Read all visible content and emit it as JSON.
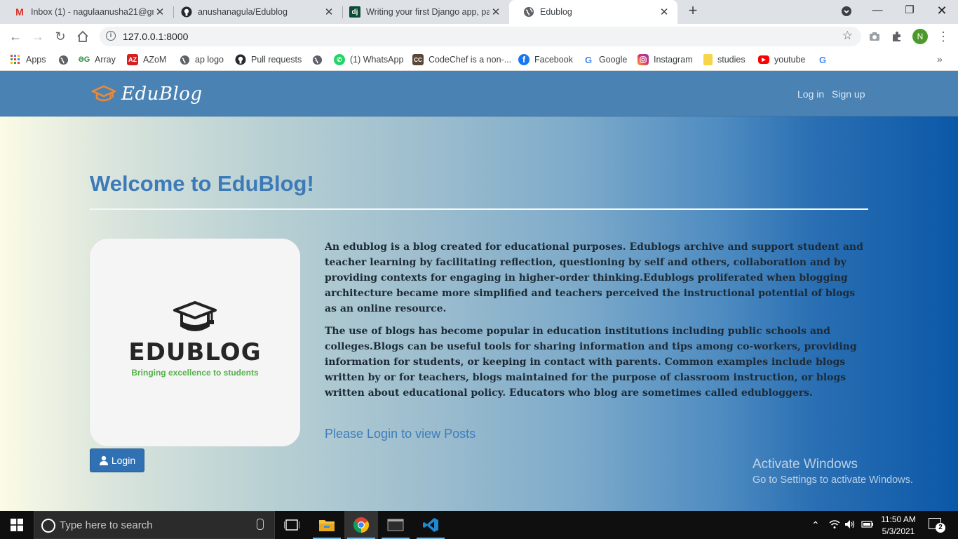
{
  "browser": {
    "tabs": [
      {
        "title": "Inbox (1) - nagulaanusha21@gm",
        "favicon": "gmail-icon",
        "active": false
      },
      {
        "title": "anushanagula/Edublog",
        "favicon": "github-icon",
        "active": false
      },
      {
        "title": "Writing your first Django app, pa",
        "favicon": "django-icon",
        "active": false
      },
      {
        "title": "Edublog",
        "favicon": "globe-icon",
        "active": true
      }
    ],
    "new_tab_label": "+",
    "url": "127.0.0.1:8000",
    "profile_initial": "N",
    "bookmarks": [
      {
        "label": "Apps",
        "icon": "apps-grid-icon"
      },
      {
        "label": "",
        "icon": "globe-icon"
      },
      {
        "label": "Array",
        "icon": "gfg-icon"
      },
      {
        "label": "AZoM",
        "icon": "azom-icon"
      },
      {
        "label": "ap logo",
        "icon": "globe-icon"
      },
      {
        "label": "Pull requests",
        "icon": "github-icon"
      },
      {
        "label": "",
        "icon": "globe-icon"
      },
      {
        "label": "(1) WhatsApp",
        "icon": "whatsapp-icon"
      },
      {
        "label": "CodeChef is a non-...",
        "icon": "codechef-icon"
      },
      {
        "label": "Facebook",
        "icon": "facebook-icon"
      },
      {
        "label": "Google",
        "icon": "google-icon"
      },
      {
        "label": "Instagram",
        "icon": "instagram-icon"
      },
      {
        "label": "studies",
        "icon": "folder-icon"
      },
      {
        "label": "youtube",
        "icon": "youtube-icon"
      },
      {
        "label": "",
        "icon": "google-icon"
      }
    ],
    "more_bookmarks": "»"
  },
  "site": {
    "brand": "EduBlog",
    "nav": {
      "login": "Log in",
      "signup": "Sign up"
    },
    "heading": "Welcome to EduBlog!",
    "logo": {
      "wordmark": "EDUBLOG",
      "tagline": "Bringing excellence to students"
    },
    "login_button": "Login",
    "paragraphs": [
      "An edublog is a blog created for educational purposes. Edublogs archive and support student and teacher learning by facilitating reflection, questioning by self and others, collaboration and by providing contexts for engaging in higher-order thinking.Edublogs proliferated when blogging architecture became more simplified and teachers perceived the instructional potential of blogs as an online resource.",
      "The use of blogs has become popular in education institutions including public schools and colleges.Blogs can be useful tools for sharing information and tips among co-workers, providing information for students, or keeping in contact with parents. Common examples include blogs written by or for teachers, blogs maintained for the purpose of classroom instruction, or blogs written about educational policy. Educators who blog are sometimes called edubloggers."
    ],
    "login_prompt": "Please Login to view Posts"
  },
  "watermark": {
    "title": "Activate Windows",
    "subtitle": "Go to Settings to activate Windows."
  },
  "taskbar": {
    "search_placeholder": "Type here to search",
    "time": "11:50 AM",
    "date": "5/3/2021",
    "notification_count": "2"
  },
  "colors": {
    "nav_bg": "#4a82b4",
    "heading": "#3d7ab8",
    "button": "#2f71b3",
    "tagline_green": "#55b14a",
    "brand_cap_orange": "#e8883a"
  }
}
